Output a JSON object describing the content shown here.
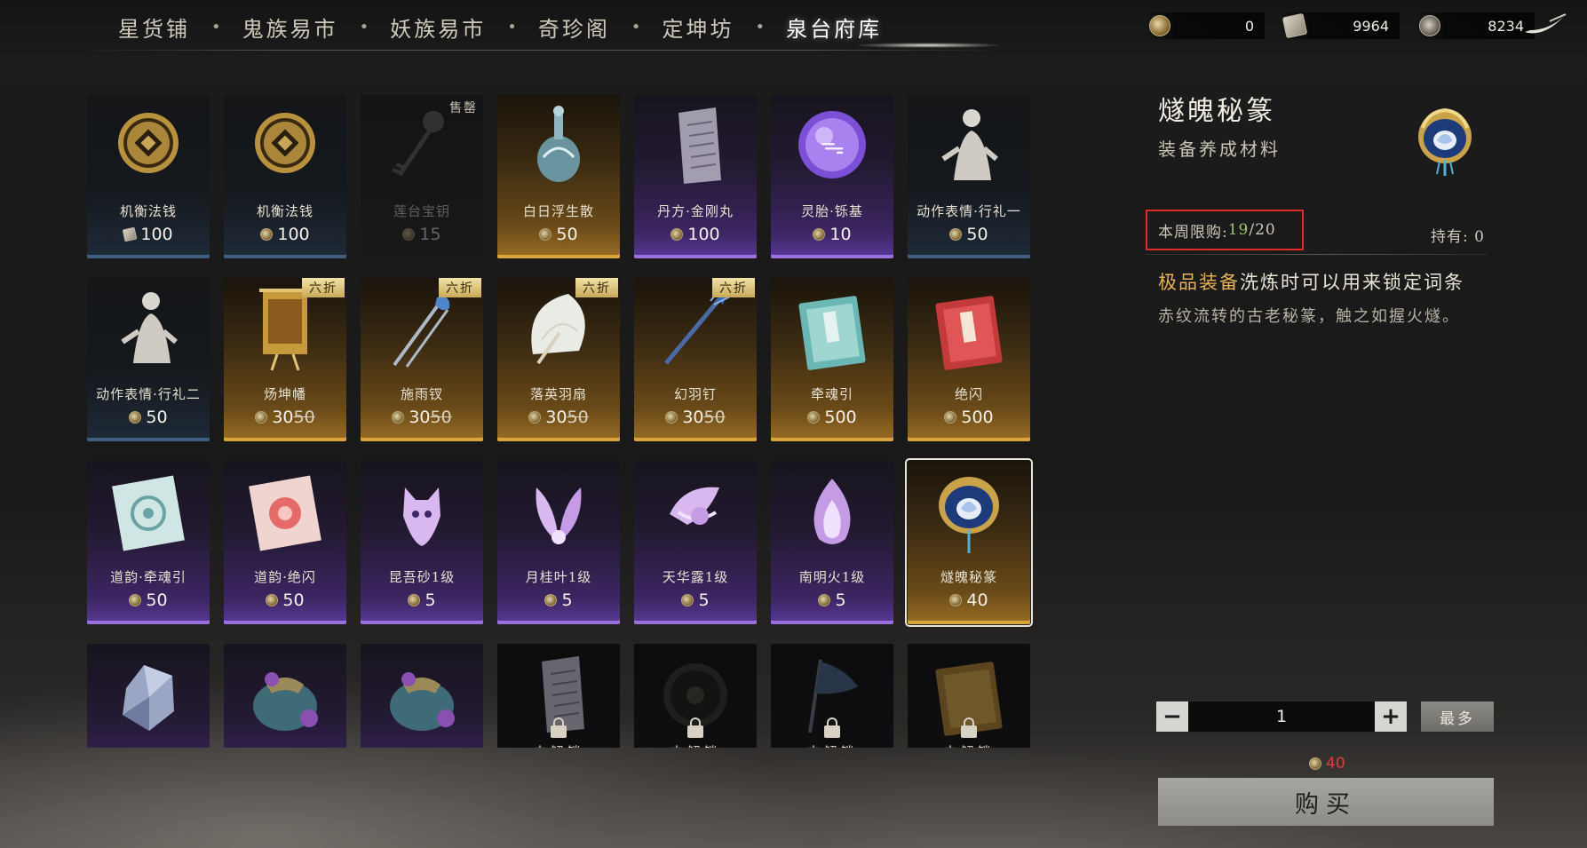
{
  "nav": {
    "tabs": [
      "星货铺",
      "鬼族易市",
      "妖族易市",
      "奇珍阁",
      "定坤坊",
      "泉台府库"
    ],
    "active": "泉台府库",
    "currencies": [
      {
        "icon": "coin-icon",
        "value": "0"
      },
      {
        "icon": "scroll-currency-icon",
        "value": "9964"
      },
      {
        "icon": "shell-currency-icon",
        "value": "8234"
      }
    ]
  },
  "items": [
    {
      "name": "机衡法钱",
      "price": "100",
      "currency": "scroll",
      "rarity": "blue",
      "art": "coin"
    },
    {
      "name": "机衡法钱",
      "price": "100",
      "currency": "coin",
      "rarity": "blue",
      "art": "coin"
    },
    {
      "name": "莲台宝钥",
      "price": "15",
      "currency": "coin",
      "rarity": "dark",
      "art": "key",
      "sold_out": "售罄"
    },
    {
      "name": "白日浮生散",
      "price": "50",
      "currency": "coin",
      "rarity": "gold",
      "art": "vase"
    },
    {
      "name": "丹方·金刚丸",
      "price": "100",
      "currency": "coin",
      "rarity": "purple",
      "art": "paper"
    },
    {
      "name": "灵胎·铄基",
      "price": "10",
      "currency": "coin",
      "rarity": "purple",
      "art": "orb"
    },
    {
      "name": "动作表情·行礼一",
      "price": "50",
      "currency": "coin",
      "rarity": "blue",
      "art": "figure"
    },
    {
      "name": "动作表情·行礼二",
      "price": "50",
      "currency": "coin",
      "rarity": "blue",
      "art": "figure"
    },
    {
      "name": "炀坤幡",
      "price": "30",
      "old_price": "50",
      "currency": "coin",
      "rarity": "gold",
      "art": "banner",
      "badge": "六折"
    },
    {
      "name": "施雨钗",
      "price": "30",
      "old_price": "50",
      "currency": "coin",
      "rarity": "gold",
      "art": "hairpin",
      "badge": "六折"
    },
    {
      "name": "落英羽扇",
      "price": "30",
      "old_price": "50",
      "currency": "coin",
      "rarity": "gold",
      "art": "fan",
      "badge": "六折"
    },
    {
      "name": "幻羽钉",
      "price": "30",
      "old_price": "50",
      "currency": "coin",
      "rarity": "gold",
      "art": "spike",
      "badge": "六折"
    },
    {
      "name": "牵魂引",
      "price": "500",
      "currency": "coin",
      "rarity": "gold",
      "art": "book-teal"
    },
    {
      "name": "绝闪",
      "price": "500",
      "currency": "coin",
      "rarity": "gold",
      "art": "book-red"
    },
    {
      "name": "道韵·牵魂引",
      "price": "50",
      "currency": "coin",
      "rarity": "purple",
      "art": "scroll-teal"
    },
    {
      "name": "道韵·绝闪",
      "price": "50",
      "currency": "coin",
      "rarity": "purple",
      "art": "scroll-red"
    },
    {
      "name": "昆吾砂1级",
      "price": "5",
      "currency": "coin",
      "rarity": "purple",
      "art": "fox"
    },
    {
      "name": "月桂叶1级",
      "price": "5",
      "currency": "coin",
      "rarity": "purple",
      "art": "leaf"
    },
    {
      "name": "天华露1级",
      "price": "5",
      "currency": "coin",
      "rarity": "purple",
      "art": "dew"
    },
    {
      "name": "南明火1级",
      "price": "5",
      "currency": "coin",
      "rarity": "purple",
      "art": "flame"
    },
    {
      "name": "燧魄秘篆",
      "price": "40",
      "currency": "coin",
      "rarity": "gold",
      "art": "jewel",
      "selected": true
    },
    {
      "name": "",
      "price": "",
      "rarity": "purple",
      "art": "crystal"
    },
    {
      "name": "",
      "price": "",
      "rarity": "purple",
      "art": "pouch"
    },
    {
      "name": "",
      "price": "",
      "rarity": "purple",
      "art": "pouch"
    },
    {
      "name": "",
      "price": "",
      "rarity": "dark",
      "art": "paper",
      "locked": "未解锁"
    },
    {
      "name": "",
      "price": "",
      "rarity": "dark",
      "art": "disc",
      "locked": "未解锁"
    },
    {
      "name": "",
      "price": "",
      "rarity": "dark",
      "art": "flag",
      "locked": "未解锁"
    },
    {
      "name": "",
      "price": "",
      "rarity": "dark",
      "art": "book-gold",
      "locked": "未解锁"
    }
  ],
  "detail": {
    "title": "燧魄秘篆",
    "type": "装备养成材料",
    "limit_label": "本周限购: ",
    "limit_used": "19",
    "limit_total": "/20",
    "hold": "持有: 0",
    "desc_highlight": "极品装备",
    "desc_rest": "洗炼时可以用来锁定词条",
    "desc_sub": "赤纹流转的古老秘篆，触之如握火燧。",
    "quantity": "1",
    "minus": "−",
    "plus": "+",
    "max_label": "最多",
    "cost": "40",
    "buy_label": "购买"
  },
  "colors": {
    "highlight": "#e8b34e",
    "limit_used": "#9fc76a",
    "cost": "#e23a3a",
    "limit_box": "#e02b2b"
  }
}
